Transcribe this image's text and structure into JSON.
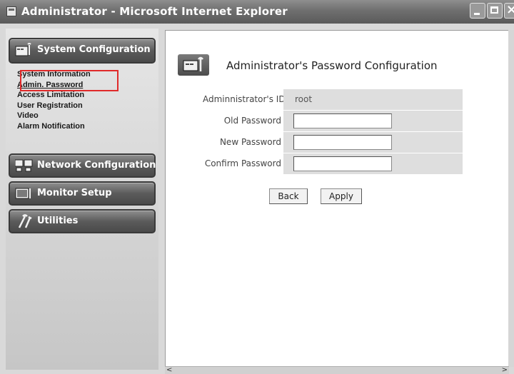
{
  "window": {
    "title": "Administrator - Microsoft Internet Explorer",
    "icon": "ie-page-icon",
    "controls": [
      "minimize-icon",
      "maximize-icon",
      "close-icon"
    ]
  },
  "sidebar": {
    "categories": [
      {
        "label": "System Configuration",
        "icon": "monitor-wrench-icon"
      },
      {
        "label": "Network Configuration",
        "icon": "network-computers-icon"
      },
      {
        "label": "Monitor Setup",
        "icon": "monitor-wrench-icon"
      },
      {
        "label": "Utilities",
        "icon": "tools-icon"
      }
    ],
    "submenu": [
      {
        "label": "System Information"
      },
      {
        "label": "Admin. Password",
        "active": true
      },
      {
        "label": "Access Limitation"
      },
      {
        "label": "User Registration"
      },
      {
        "label": "Video"
      },
      {
        "label": "Alarm Notification"
      }
    ],
    "highlight_color": "#e02a2a"
  },
  "content": {
    "title": "Administrator's Password Configuration",
    "header_icon": "monitor-wrench-icon",
    "fields": {
      "admin_id": {
        "label": "Adminnistrator's ID",
        "value": "root"
      },
      "old_password": {
        "label": "Old Password",
        "value": ""
      },
      "new_password": {
        "label": "New Password",
        "value": ""
      },
      "confirm_password": {
        "label": "Confirm Password",
        "value": ""
      }
    },
    "buttons": {
      "back": "Back",
      "apply": "Apply"
    }
  },
  "scrollbars": {
    "left_arrow": "<",
    "right_arrow": ">"
  }
}
